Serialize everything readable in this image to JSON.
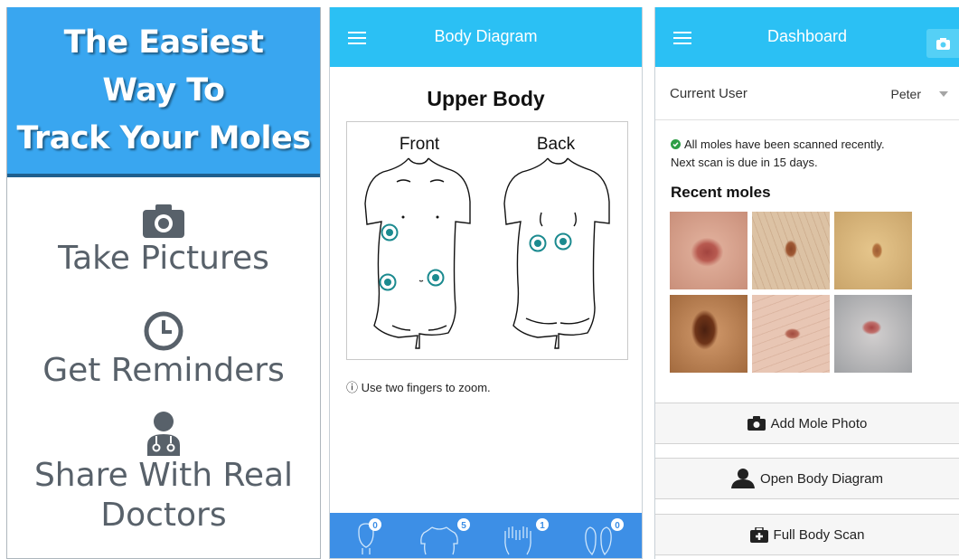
{
  "promo": {
    "headline_lines": [
      "The Easiest",
      "Way To",
      "Track Your Moles"
    ],
    "features": [
      {
        "label": "Take Pictures",
        "icon": "camera-icon"
      },
      {
        "label": "Get Reminders",
        "icon": "clock-icon"
      },
      {
        "label_lines": [
          "Share With Real",
          "Doctors"
        ],
        "icon": "doctor-icon"
      }
    ],
    "colors": {
      "hero": "#39a6f0",
      "text": "#58616a"
    }
  },
  "body_diagram": {
    "header_title": "Body Diagram",
    "section_title": "Upper Body",
    "front_label": "Front",
    "back_label": "Back",
    "hint": "ⓘ Use two fingers to zoom.",
    "tabs": [
      {
        "icon": "head-icon",
        "count": "0"
      },
      {
        "icon": "upper-body-icon",
        "count": "5"
      },
      {
        "icon": "hands-icon",
        "count": "1"
      },
      {
        "icon": "feet-icon",
        "count": "0"
      }
    ],
    "colors": {
      "header": "#2bc0f4",
      "tabbar": "#3d8fe6",
      "marker": "#1b8a8f"
    }
  },
  "dashboard": {
    "header_title": "Dashboard",
    "current_user_label": "Current User",
    "current_user_value": "Peter",
    "status_line1": "All moles have been scanned recently.",
    "status_line2": "Next scan is due in 15 days.",
    "recent_title": "Recent moles",
    "buttons": {
      "add_photo": "Add Mole Photo",
      "open_diagram": "Open Body Diagram",
      "full_scan": "Full Body Scan"
    }
  }
}
